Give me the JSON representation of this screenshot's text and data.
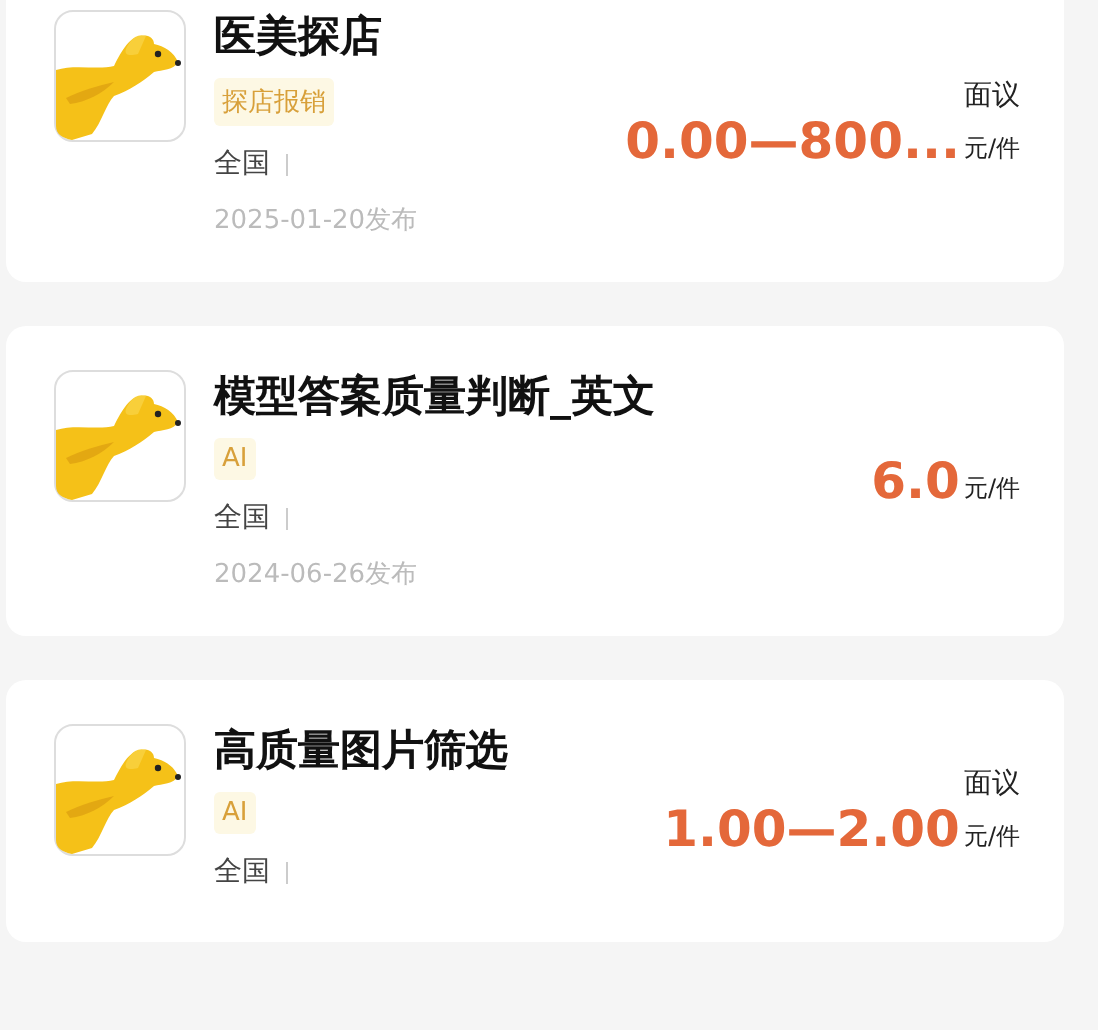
{
  "tasks": [
    {
      "title": "医美探店",
      "tag": "探店报销",
      "region": "全国",
      "date": "2025-01-20发布",
      "price": "0.00—800...",
      "negotiable": "面议",
      "unit": "元/件"
    },
    {
      "title": "模型答案质量判断_英文",
      "tag": "AI",
      "region": "全国",
      "date": "2024-06-26发布",
      "price": "6.0",
      "unit": "元/件"
    },
    {
      "title": "高质量图片筛选",
      "tag": "AI",
      "region": "全国",
      "price": "1.00—2.00",
      "negotiable": "面议",
      "unit": "元/件"
    }
  ]
}
